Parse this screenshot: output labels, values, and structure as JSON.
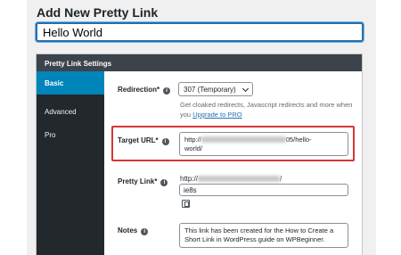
{
  "page": {
    "title": "Add New Pretty Link"
  },
  "title_field": {
    "value": "Hello World"
  },
  "panel": {
    "header": "Pretty Link Settings",
    "tabs": [
      {
        "label": "Basic",
        "active": true
      },
      {
        "label": "Advanced",
        "active": false
      },
      {
        "label": "Pro",
        "active": false
      }
    ]
  },
  "fields": {
    "redirection": {
      "label": "Redirection*",
      "selected": "307 (Temporary)",
      "help_text": "Get cloaked redirects, Javascript redirects and more when you",
      "help_link": "Upgrade to PRO"
    },
    "target_url": {
      "label": "Target URL*",
      "value_start": "http://",
      "value_end": "05/hello-",
      "value_line2": "world/"
    },
    "pretty_link": {
      "label": "Pretty Link*",
      "prefix_start": "http://",
      "prefix_end": "/",
      "slug": "ie8s"
    },
    "notes": {
      "label": "Notes",
      "value": "This link has been created for the How to Create a Short Link in WordPress guide on WPBeginner."
    }
  },
  "colors": {
    "accent": "#0085ba",
    "sidebar": "#23282d",
    "header": "#3c434a",
    "highlight": "#d63638"
  },
  "icons": {
    "info": "info-circle-icon",
    "copy": "copy-icon",
    "dropdown": "chevron-down-icon"
  }
}
